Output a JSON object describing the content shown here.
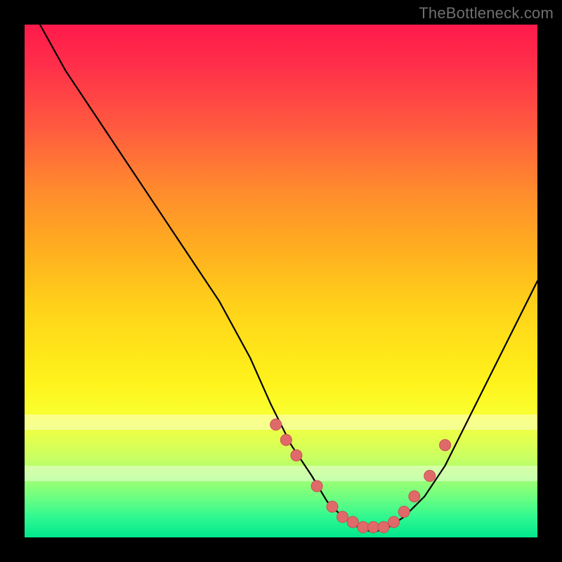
{
  "watermark": "TheBottleneck.com",
  "chart_data": {
    "type": "line",
    "title": "",
    "xlabel": "",
    "ylabel": "",
    "xlim": [
      0,
      100
    ],
    "ylim": [
      0,
      100
    ],
    "grid": false,
    "legend": false,
    "annotations": [],
    "white_bands_y_pct": [
      {
        "start": 76,
        "end": 79
      },
      {
        "start": 86,
        "end": 89
      }
    ],
    "series": [
      {
        "name": "bottleneck-curve",
        "x": [
          3,
          8,
          14,
          20,
          26,
          32,
          38,
          44,
          48,
          52,
          56,
          59,
          62,
          65,
          68,
          71,
          74,
          78,
          82,
          86,
          90,
          94,
          98,
          100
        ],
        "y": [
          100,
          91,
          82,
          73,
          64,
          55,
          46,
          35,
          26,
          18,
          12,
          7,
          4,
          2,
          1,
          2,
          4,
          8,
          14,
          22,
          30,
          38,
          46,
          50
        ]
      }
    ],
    "scatter": {
      "name": "highlight-points",
      "x": [
        49,
        51,
        53,
        57,
        60,
        62,
        64,
        66,
        68,
        70,
        72,
        74,
        76,
        79,
        82
      ],
      "y": [
        22,
        19,
        16,
        10,
        6,
        4,
        3,
        2,
        2,
        2,
        3,
        5,
        8,
        12,
        18
      ]
    }
  }
}
